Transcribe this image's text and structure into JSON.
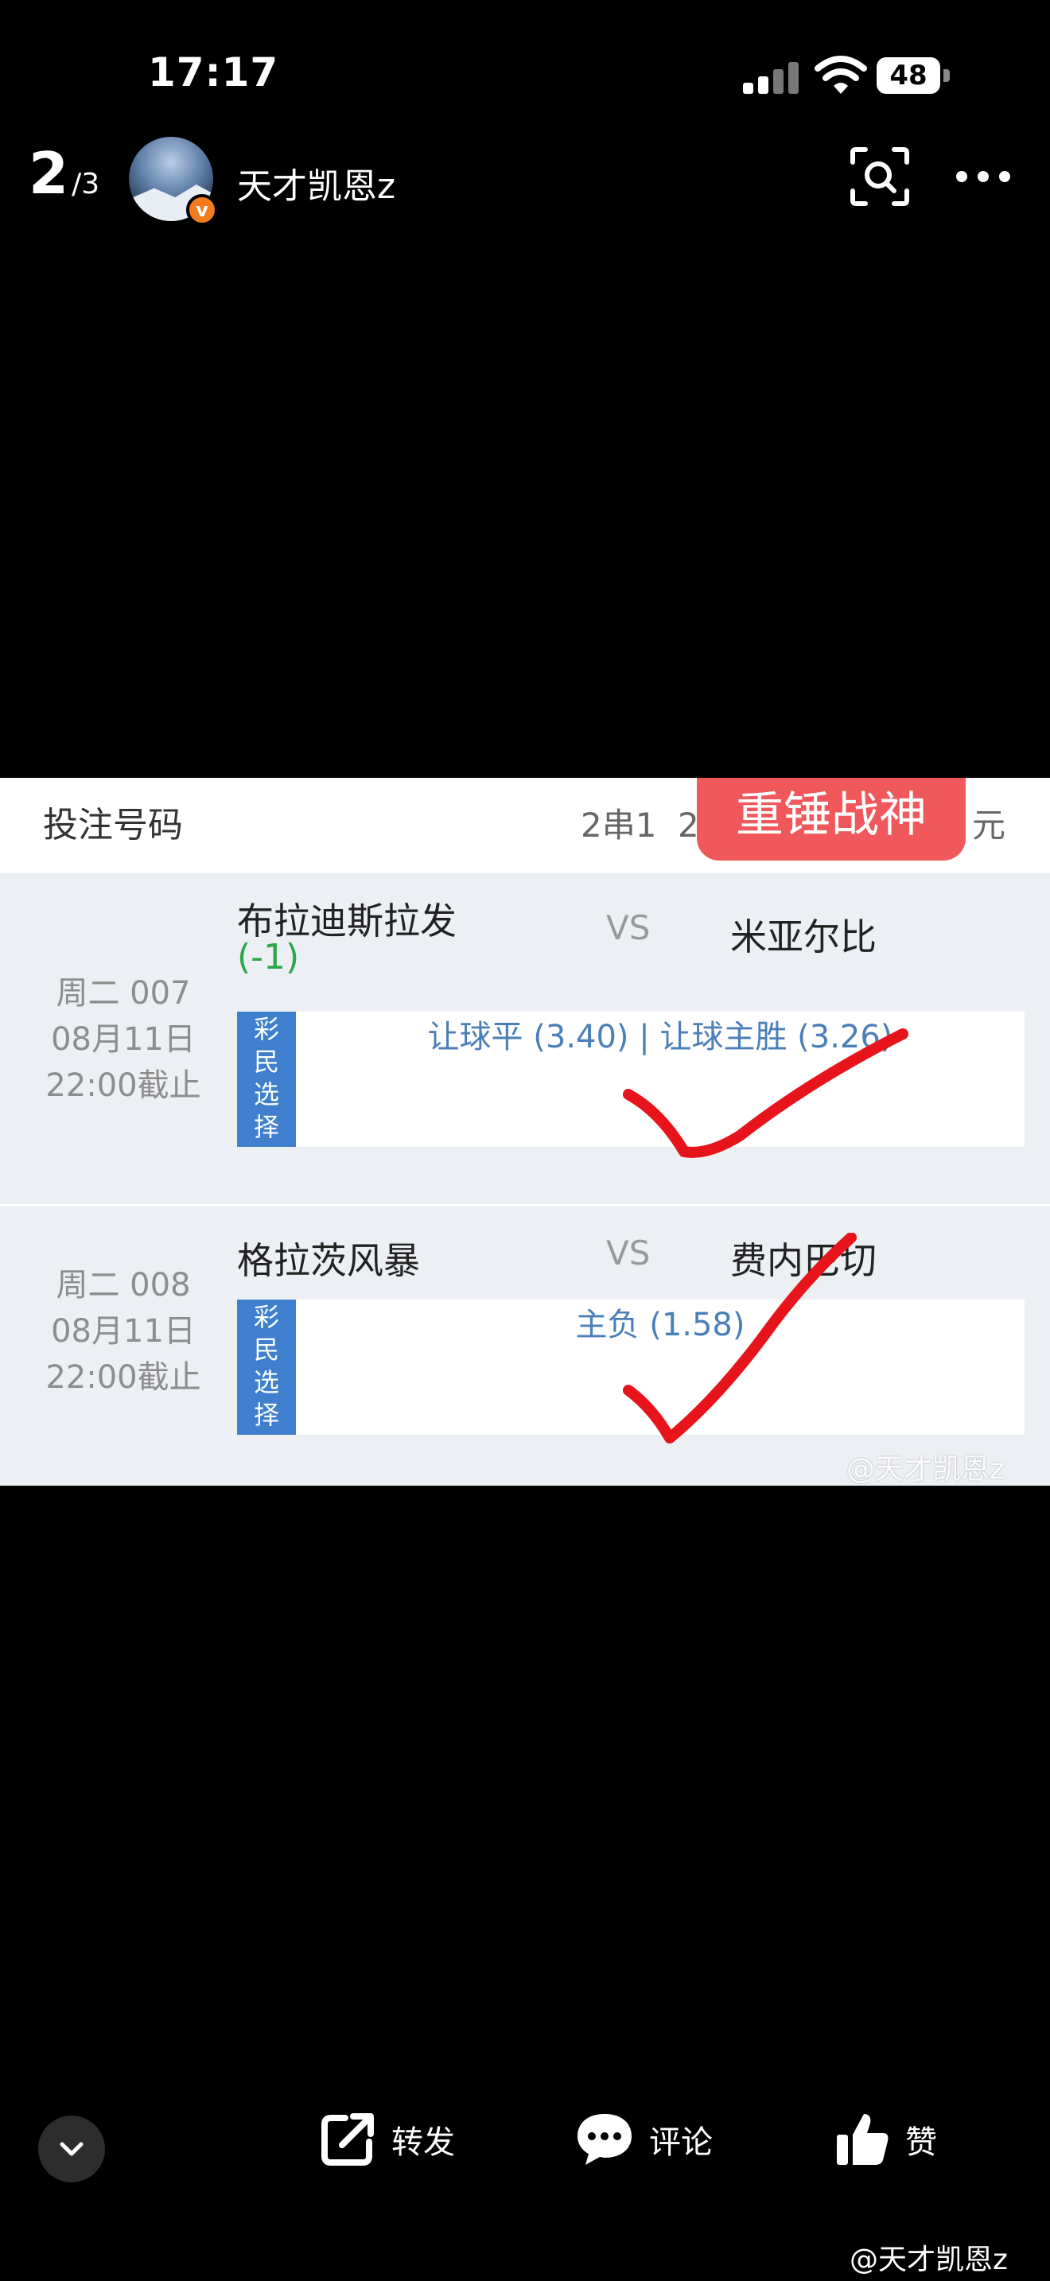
{
  "status_bar": {
    "time": "17:17",
    "battery": "48"
  },
  "top_bar": {
    "page_current": "2",
    "page_total": "/3",
    "username": "天才凯恩z",
    "verify_badge": "v"
  },
  "ticket": {
    "header_label": "投注号码",
    "bet_type": "2串1",
    "bet_type_partial": "2",
    "unit": "元",
    "sticker": "重锤战神",
    "matches": [
      {
        "day_no": "周二 007",
        "date": "08月11日",
        "deadline": "22:00截止",
        "home": "布拉迪斯拉发",
        "handicap": "(-1)",
        "vs": "VS",
        "away": "米亚尔比",
        "tag": [
          "彩",
          "民",
          "选",
          "择"
        ],
        "pick": "让球平 (3.40) | 让球主胜 (3.26)"
      },
      {
        "day_no": "周二 008",
        "date": "08月11日",
        "deadline": "22:00截止",
        "home": "格拉茨风暴",
        "vs": "VS",
        "away": "费内巴切",
        "tag": [
          "彩",
          "民",
          "选",
          "择"
        ],
        "pick": "主负 (1.58)"
      }
    ],
    "watermark": "@天才凯恩z"
  },
  "actions": {
    "share": "转发",
    "comment": "评论",
    "like": "赞"
  },
  "bottom_watermark": "@天才凯恩z",
  "colors": {
    "sticker": "#f0585c",
    "tag": "#3f7fcd",
    "pick_text": "#4a7fb8",
    "check": "#e8141c",
    "handicap": "#2ea64a"
  }
}
